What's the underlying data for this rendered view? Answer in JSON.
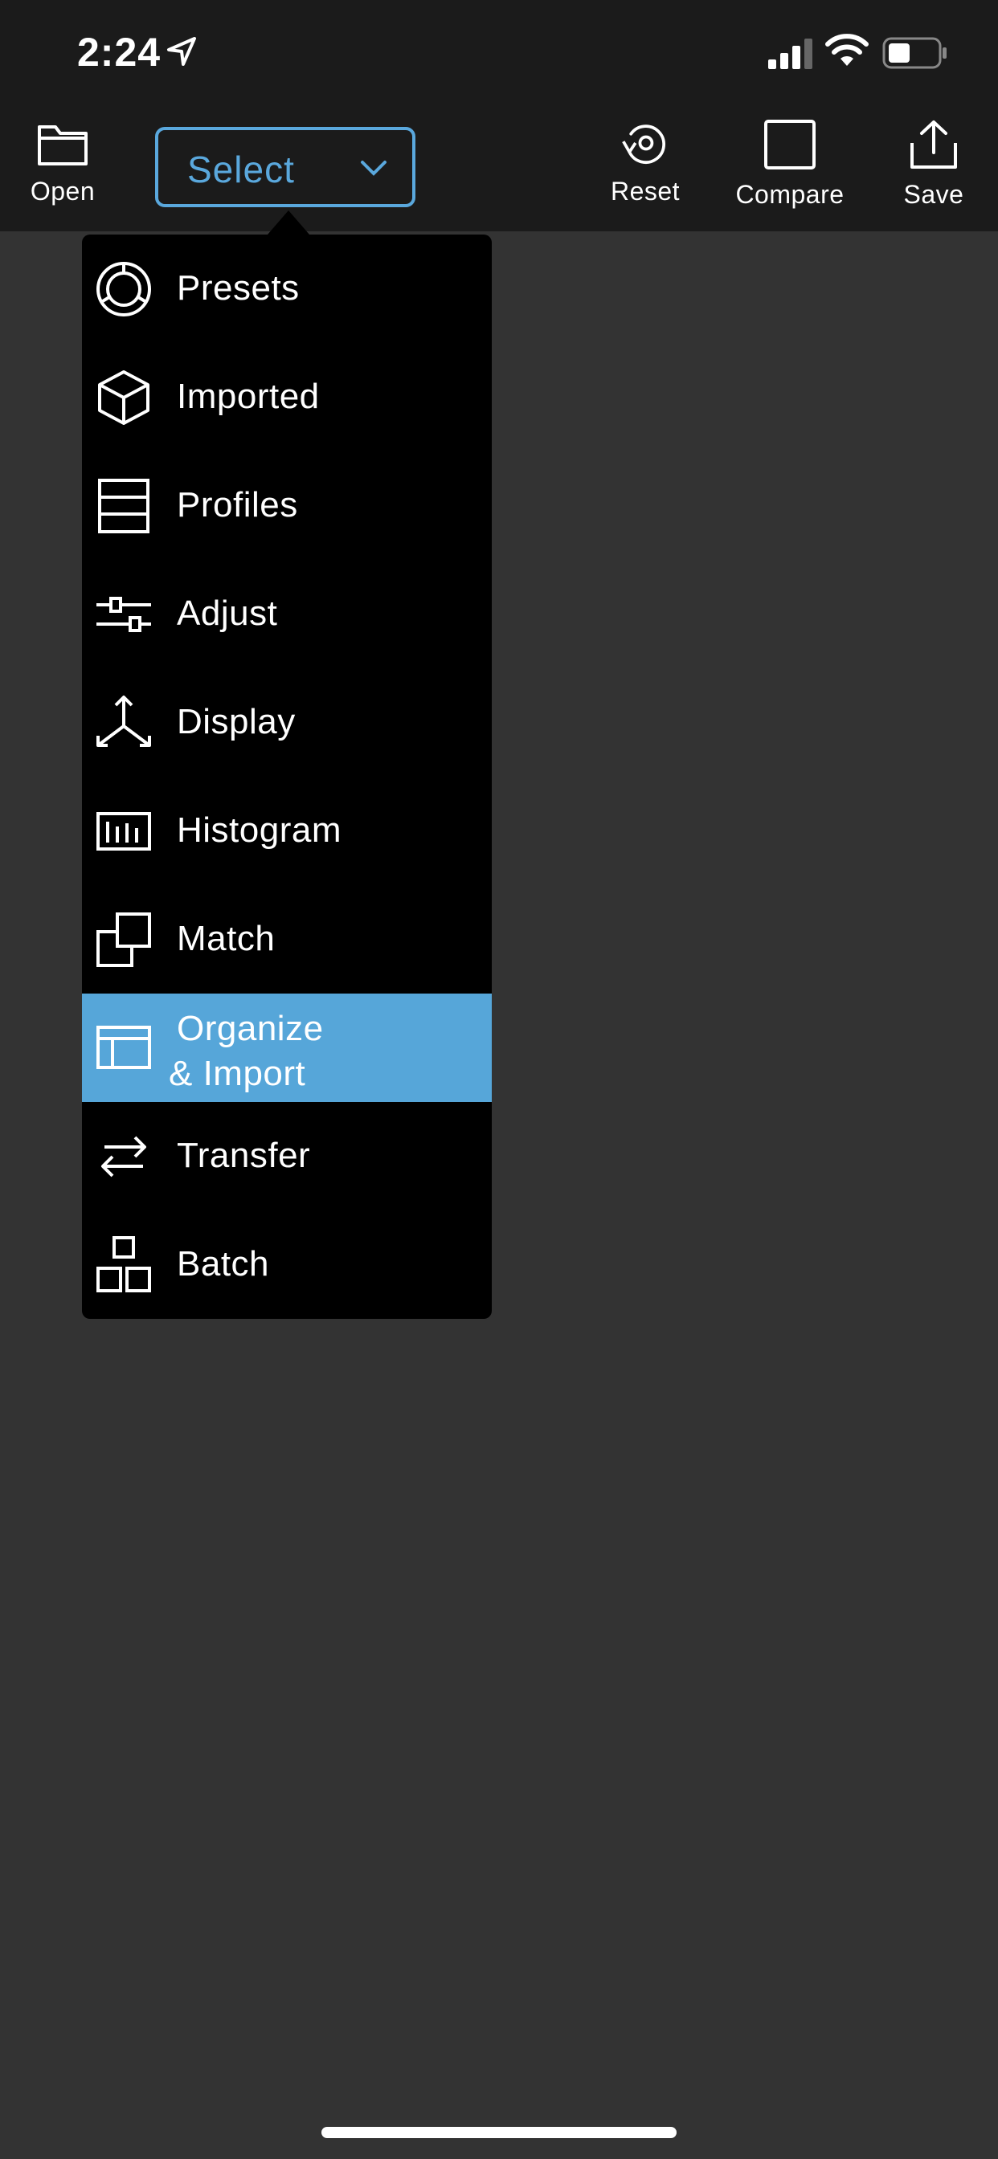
{
  "status_bar": {
    "time": "2:24"
  },
  "toolbar": {
    "open_label": "Open",
    "select_label": "Select",
    "reset_label": "Reset",
    "compare_label": "Compare",
    "save_label": "Save"
  },
  "menu": {
    "items": [
      {
        "label": "Presets",
        "icon": "presets-icon"
      },
      {
        "label": "Imported",
        "icon": "cube-icon"
      },
      {
        "label": "Profiles",
        "icon": "profiles-icon"
      },
      {
        "label": "Adjust",
        "icon": "sliders-icon"
      },
      {
        "label": "Display",
        "icon": "axes-icon"
      },
      {
        "label": "Histogram",
        "icon": "histogram-icon"
      },
      {
        "label": "Match",
        "icon": "match-icon"
      },
      {
        "label_line1": "Organize",
        "label_line2": "& Import",
        "icon": "organize-icon",
        "selected": true
      },
      {
        "label": "Transfer",
        "icon": "transfer-icon"
      },
      {
        "label": "Batch",
        "icon": "batch-icon"
      }
    ]
  },
  "colors": {
    "accent": "#5aa8dd",
    "selected_row": "#56a6d9",
    "background": "#333333",
    "toolbar": "#1b1b1b",
    "menu": "#000000"
  }
}
